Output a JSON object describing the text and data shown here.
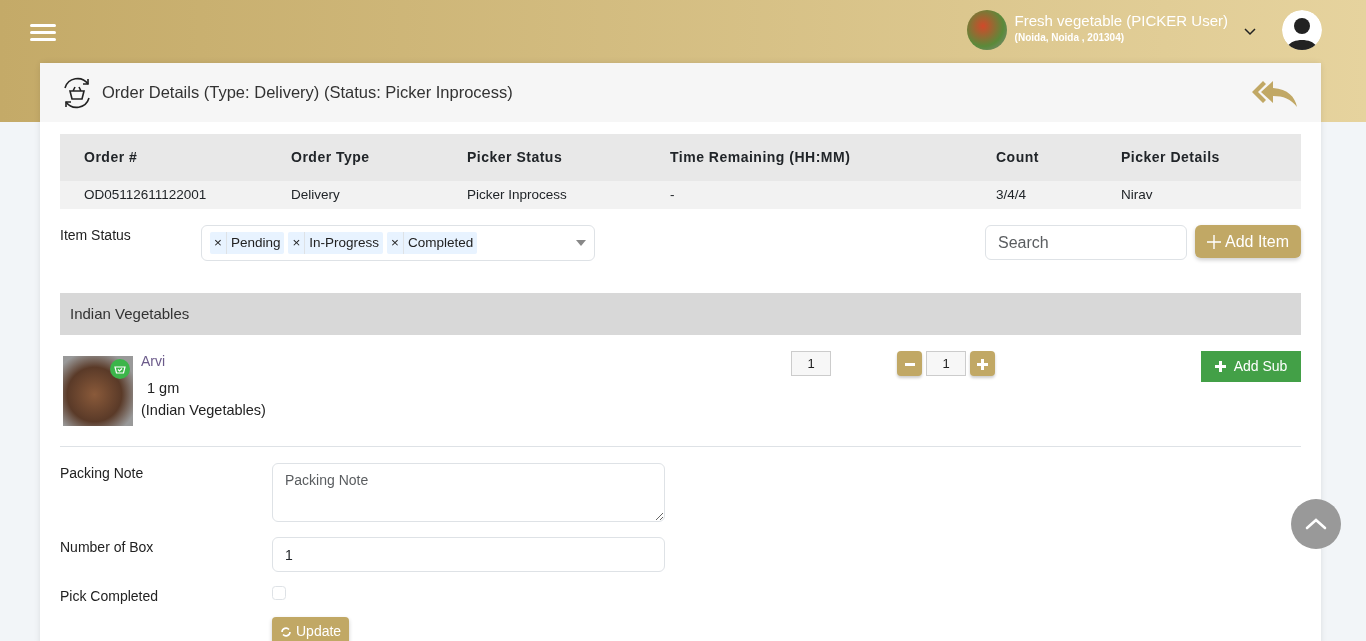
{
  "header": {
    "store_name": "Fresh vegetable (PICKER User)",
    "store_address": "(Noida, Noida , 201304)"
  },
  "card": {
    "title": "Order Details (Type: Delivery) (Status: Picker Inprocess)"
  },
  "order_table": {
    "columns": [
      "Order #",
      "Order Type",
      "Picker Status",
      "Time Remaining (HH:MM)",
      "Count",
      "Picker Details"
    ],
    "rows": [
      [
        "OD05112611122001",
        "Delivery",
        "Picker Inprocess",
        "-",
        "3/4/4",
        "Nirav"
      ]
    ]
  },
  "item_status": {
    "label": "Item Status",
    "tags": [
      {
        "remove": "×",
        "label": "Pending"
      },
      {
        "remove": "×",
        "label": "In-Progress"
      },
      {
        "remove": "×",
        "label": "Completed"
      }
    ]
  },
  "search": {
    "placeholder": "Search"
  },
  "add_item_button": "Add Item",
  "categories": [
    {
      "name": "Indian Vegetables",
      "items": [
        {
          "name": "Arvi",
          "quantity": "1 gm",
          "category": "(Indian Vegetables)",
          "ordered": "1",
          "picked": "1",
          "add_sub_button": "Add Sub"
        }
      ]
    }
  ],
  "form": {
    "packing_note": {
      "label": "Packing Note",
      "placeholder": "Packing Note"
    },
    "number_of_box": {
      "label": "Number of Box",
      "value": "1"
    },
    "pick_completed": {
      "label": "Pick Completed",
      "checked": false
    },
    "update_button": "Update"
  }
}
